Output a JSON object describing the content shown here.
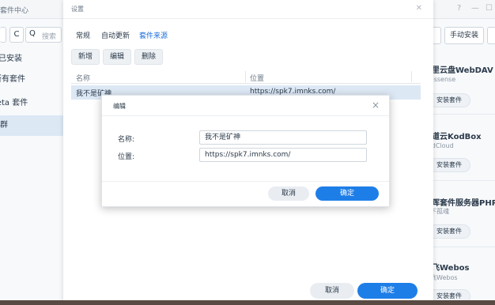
{
  "background": {
    "window_title": "套件中心",
    "window_controls": [
      "?",
      "—",
      "☐"
    ],
    "toolbar": {
      "refresh_icon": "refresh-icon",
      "search_placeholder": "搜索"
    },
    "nav_items": [
      {
        "label": "已安装",
        "active": false
      },
      {
        "label": "所有套件",
        "active": false
      },
      {
        "label": "Beta 套件",
        "active": false
      },
      {
        "label": "社群",
        "active": true
      }
    ],
    "right_buttons": {
      "manual_install": "手动安装"
    },
    "cards": [
      {
        "title": "阿里云盘WebDAV",
        "subtitle": "messense",
        "button": "安装套件"
      },
      {
        "title": "可道云KodBox",
        "subtitle": "KodCloud",
        "button": "安装套件"
      },
      {
        "title": "群晖套件服务器PHP",
        "subtitle": "矿下孤魂",
        "button": "安装套件"
      },
      {
        "title": "阿飞Webos",
        "subtitle": "阿飞Webos",
        "button": "安装套件"
      }
    ]
  },
  "settings": {
    "title": "设置",
    "tabs": [
      {
        "label": "常规",
        "active": false
      },
      {
        "label": "自动更新",
        "active": false
      },
      {
        "label": "套件来源",
        "active": true
      }
    ],
    "actions": {
      "add": "新增",
      "edit": "编辑",
      "delete": "删除"
    },
    "table": {
      "columns": [
        "名称",
        "位置"
      ],
      "rows": [
        {
          "name": "我不是矿神",
          "location": "https://spk7.imnks.com/"
        }
      ]
    },
    "footer": {
      "cancel": "取消",
      "ok": "确定"
    }
  },
  "edit_dialog": {
    "title": "编辑",
    "name_label": "名称:",
    "name_value": "我不是矿神",
    "location_label": "位置:",
    "location_value": "https://spk7.imnks.com/",
    "cancel": "取消",
    "ok": "确定"
  },
  "colors": {
    "accent": "#1e7ee8",
    "selected_row": "#dde8f5"
  }
}
